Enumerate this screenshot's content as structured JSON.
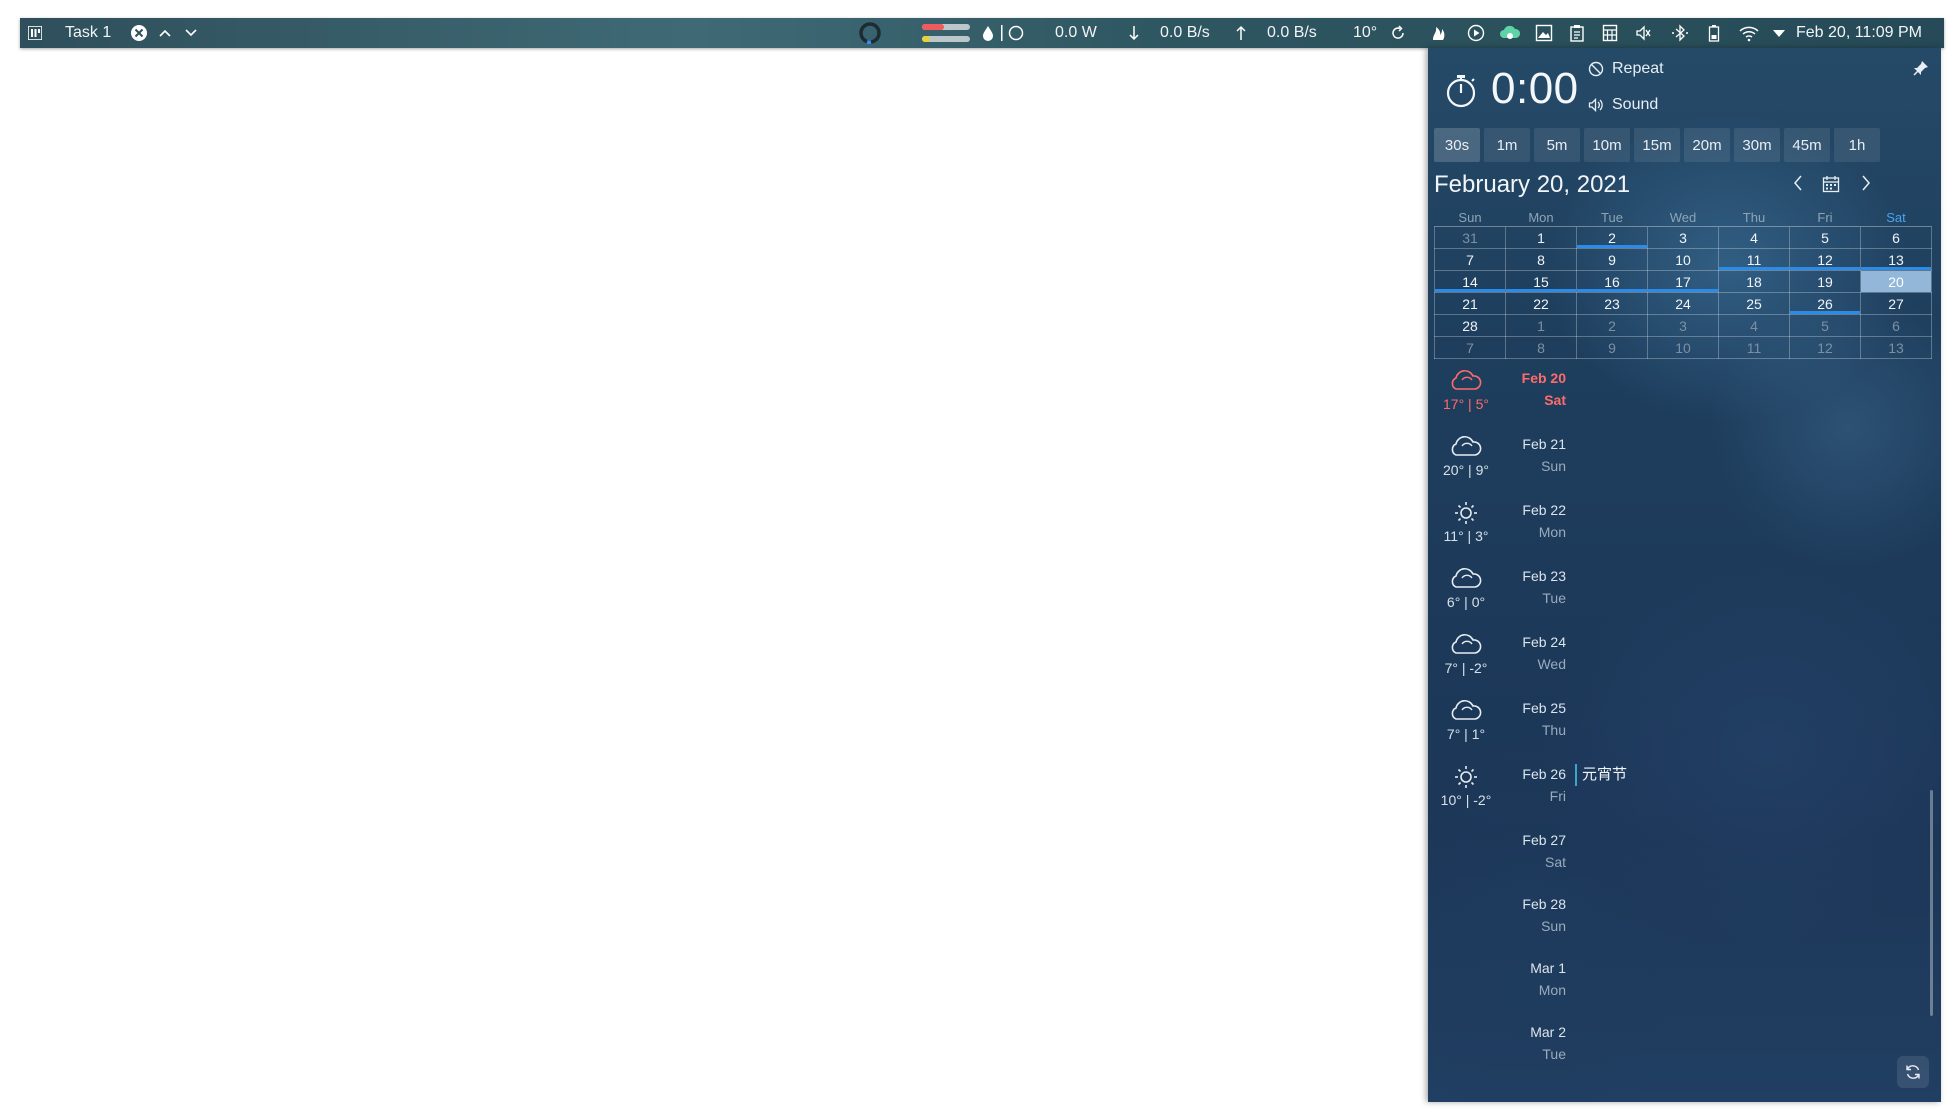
{
  "taskbar": {
    "task_label": "Task 1",
    "power": "0.0 W",
    "download": "0.0 B/s",
    "upload": "0.0 B/s",
    "temperature": "10°",
    "clock": "Feb 20, 11:09 PM",
    "icons": [
      "app-menu-icon",
      "close-icon",
      "chevron-up-icon",
      "chevron-down-icon",
      "loading-ring-icon",
      "memory-bar-icon",
      "droplet-icon",
      "circle-icon",
      "arrow-down-icon",
      "arrow-up-icon",
      "refresh-icon",
      "flame-icon",
      "play-icon",
      "cloud-sync-icon",
      "image-icon",
      "clipboard-icon",
      "calculator-icon",
      "speaker-mute-icon",
      "bluetooth-icon",
      "battery-icon",
      "wifi-icon",
      "triangle-down-icon"
    ]
  },
  "timer": {
    "value": "0:00",
    "repeat_label": "Repeat",
    "sound_label": "Sound",
    "presets": [
      "30s",
      "1m",
      "5m",
      "10m",
      "15m",
      "20m",
      "30m",
      "45m",
      "1h"
    ],
    "active_preset": "30s"
  },
  "calendar": {
    "title": "February 20, 2021",
    "weekdays": [
      "Sun",
      "Mon",
      "Tue",
      "Wed",
      "Thu",
      "Fri",
      "Sat"
    ],
    "weeks": [
      [
        [
          "31",
          "dim"
        ],
        [
          "1",
          ""
        ],
        [
          "2",
          "event"
        ],
        [
          "3",
          ""
        ],
        [
          "4",
          ""
        ],
        [
          "5",
          ""
        ],
        [
          "6",
          ""
        ]
      ],
      [
        [
          "7",
          ""
        ],
        [
          "8",
          ""
        ],
        [
          "9",
          ""
        ],
        [
          "10",
          ""
        ],
        [
          "11",
          "event"
        ],
        [
          "12",
          "event"
        ],
        [
          "13",
          "event"
        ]
      ],
      [
        [
          "14",
          "event"
        ],
        [
          "15",
          "event"
        ],
        [
          "16",
          "event"
        ],
        [
          "17",
          "event"
        ],
        [
          "18",
          ""
        ],
        [
          "19",
          ""
        ],
        [
          "20",
          "today"
        ]
      ],
      [
        [
          "21",
          ""
        ],
        [
          "22",
          ""
        ],
        [
          "23",
          ""
        ],
        [
          "24",
          ""
        ],
        [
          "25",
          ""
        ],
        [
          "26",
          "event"
        ],
        [
          "27",
          ""
        ]
      ],
      [
        [
          "28",
          ""
        ],
        [
          "1",
          "dim"
        ],
        [
          "2",
          "dim"
        ],
        [
          "3",
          "dim"
        ],
        [
          "4",
          "dim"
        ],
        [
          "5",
          "dim"
        ],
        [
          "6",
          "dim"
        ]
      ],
      [
        [
          "7",
          "dim"
        ],
        [
          "8",
          "dim"
        ],
        [
          "9",
          "dim"
        ],
        [
          "10",
          "dim"
        ],
        [
          "11",
          "dim"
        ],
        [
          "12",
          "dim"
        ],
        [
          "13",
          "dim"
        ]
      ]
    ]
  },
  "agenda": [
    {
      "date": "Feb 20",
      "day": "Sat",
      "weather": "cloud-icon",
      "temps": "17° | 5°",
      "today": true,
      "event": ""
    },
    {
      "date": "Feb 21",
      "day": "Sun",
      "weather": "cloud-icon",
      "temps": "20° | 9°",
      "today": false,
      "event": ""
    },
    {
      "date": "Feb 22",
      "day": "Mon",
      "weather": "sun-icon",
      "temps": "11° | 3°",
      "today": false,
      "event": ""
    },
    {
      "date": "Feb 23",
      "day": "Tue",
      "weather": "cloud-icon",
      "temps": "6° | 0°",
      "today": false,
      "event": ""
    },
    {
      "date": "Feb 24",
      "day": "Wed",
      "weather": "cloud-icon",
      "temps": "7° | -2°",
      "today": false,
      "event": ""
    },
    {
      "date": "Feb 25",
      "day": "Thu",
      "weather": "cloud-icon",
      "temps": "7° | 1°",
      "today": false,
      "event": ""
    },
    {
      "date": "Feb 26",
      "day": "Fri",
      "weather": "sun-icon",
      "temps": "10° | -2°",
      "today": false,
      "event": "元宵节"
    },
    {
      "date": "Feb 27",
      "day": "Sat",
      "weather": "",
      "temps": "",
      "today": false,
      "event": ""
    },
    {
      "date": "Feb 28",
      "day": "Sun",
      "weather": "",
      "temps": "",
      "today": false,
      "event": ""
    },
    {
      "date": "Mar 1",
      "day": "Mon",
      "weather": "",
      "temps": "",
      "today": false,
      "event": ""
    },
    {
      "date": "Mar 2",
      "day": "Tue",
      "weather": "",
      "temps": "",
      "today": false,
      "event": ""
    }
  ],
  "colors": {
    "accent_blue": "#2d8be8",
    "today_red": "#ff6b6b",
    "today_cell": "#93b7d9",
    "event_border": "#3aa7c7"
  }
}
